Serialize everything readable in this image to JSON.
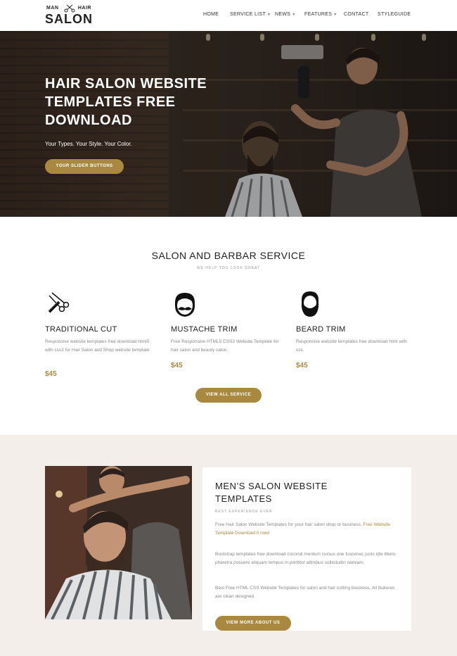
{
  "header": {
    "logo": {
      "top_left": "MAN",
      "top_right": "HAIR",
      "bottom": "SALON"
    },
    "nav": [
      {
        "label": "HOME",
        "dropdown": false
      },
      {
        "label": "SERVICE LIST",
        "dropdown": true
      },
      {
        "label": "NEWS",
        "dropdown": true
      },
      {
        "label": "FEATURES",
        "dropdown": true
      },
      {
        "label": "CONTACT",
        "dropdown": false
      },
      {
        "label": "STYLEGUIDE",
        "dropdown": false
      }
    ]
  },
  "hero": {
    "title": "HAIR SALON WEBSITE TEMPLATES FREE DOWNLOAD",
    "subtitle": "Your Types. Your Style. Your Color.",
    "button": "YOUR SLIDER BUTTONS"
  },
  "services": {
    "title": "SALON AND BARBAR SERVICE",
    "subtitle": "WE HELP YOU LOOK GREAT",
    "items": [
      {
        "icon": "scissors-comb-icon",
        "name": "TRADITIONAL CUT",
        "desc": "Responsive website templates free download html5 with css3 for Hair Salon and Shop website template",
        "price": "$45"
      },
      {
        "icon": "mustache-face-icon",
        "name": "MUSTACHE TRIM",
        "desc": "Free Responsive HTML5 CSS3 Website Template for hair salon and beauty salon.",
        "price": "$45"
      },
      {
        "icon": "beard-face-icon",
        "name": "BEARD TRIM",
        "desc": "Responsive website templates free download html with css.",
        "price": "$45"
      }
    ],
    "button": "VIEW ALL SERVICE"
  },
  "about": {
    "title": "MEN’S SALON WEBSITE TEMPLATES",
    "tag": "BEST EXPERIENCE EVER",
    "p1_text": "Free Hair Salon Website Templates for your hair salon shop or business.",
    "p1_link": "Free Website Template Download it now!",
    "p2": "Bootstrap templates free download cocondi mentum cursus one fuscenec justo idle libero pharetra posuere aliquam tempus in porttitor attinibus sollicitudin namiam.",
    "p3": "Best Free HTML CSS Website Templates for salon and hair cutting business. All features are clean designed.",
    "button": "VIEW MORE ABOUT US"
  },
  "colors": {
    "accent": "#a8893f",
    "dark": "#222222",
    "light_bg": "#f3eeea"
  }
}
